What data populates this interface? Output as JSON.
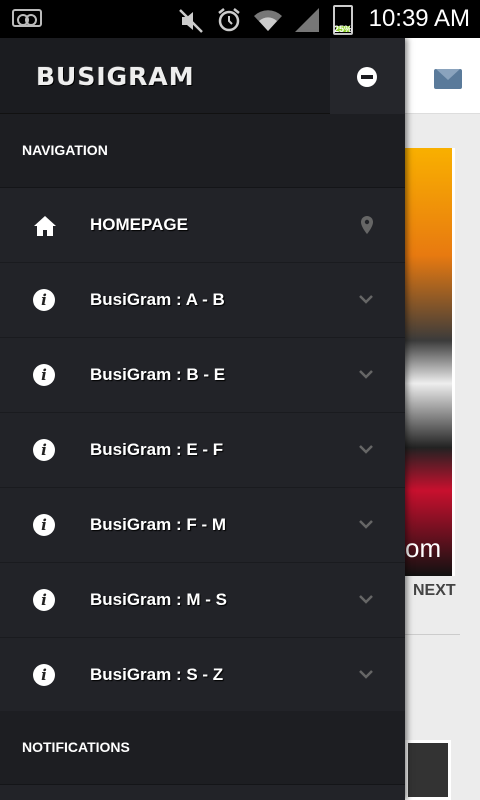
{
  "status_bar": {
    "time": "10:39 AM",
    "battery": "25%",
    "icons": [
      "voicemail-icon",
      "mute-icon",
      "alarm-icon",
      "wifi-icon",
      "signal-icon",
      "battery-icon"
    ]
  },
  "drawer": {
    "logo": "BUSIGRAM",
    "close_icon": "minus-circle-icon",
    "sections": {
      "navigation": "NAVIGATION",
      "notifications": "NOTIFICATIONS"
    },
    "items": [
      {
        "label": "HOMEPAGE",
        "icon": "home-icon",
        "trailing": "location-pin-icon"
      },
      {
        "label": "BusiGram : A - B",
        "icon": "info-icon",
        "trailing": "chevron-down-icon"
      },
      {
        "label": "BusiGram : B - E",
        "icon": "info-icon",
        "trailing": "chevron-down-icon"
      },
      {
        "label": "BusiGram : E - F",
        "icon": "info-icon",
        "trailing": "chevron-down-icon"
      },
      {
        "label": "BusiGram : F - M",
        "icon": "info-icon",
        "trailing": "chevron-down-icon"
      },
      {
        "label": "BusiGram : M - S",
        "icon": "info-icon",
        "trailing": "chevron-down-icon"
      },
      {
        "label": "BusiGram : S - Z",
        "icon": "info-icon",
        "trailing": "chevron-down-icon"
      }
    ]
  },
  "background": {
    "next_label": "NEXT",
    "photo_text": "om"
  },
  "colors": {
    "drawer_bg": "#222328",
    "header_bg": "#1b1c20",
    "text": "#ffffff",
    "battery": "#8fd12e"
  }
}
